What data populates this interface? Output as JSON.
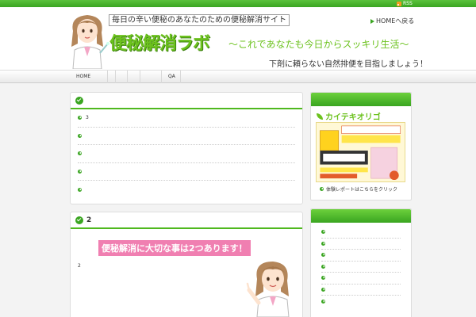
{
  "topbar": {
    "rss_label": "RSS"
  },
  "header": {
    "tagline": "毎日の辛い便秘のあなたのための便秘解消サイト",
    "home_back": "HOMEへ戻る",
    "site_title": "便秘解消ラボ",
    "site_subtitle": "〜これであなたも今日からスッキリ生活〜",
    "site_description": "下剤に頼らない自然排便を目指しましょう！"
  },
  "nav": {
    "items": [
      "HOME",
      "",
      "",
      "",
      "",
      "QA"
    ]
  },
  "main": {
    "card1": {
      "title": "",
      "items": [
        "3",
        "",
        "",
        "",
        ""
      ]
    },
    "card2": {
      "title": "2",
      "banner": "便秘解消に大切な事は2つあります！",
      "body": "2"
    }
  },
  "sidebar": {
    "banner": {
      "title": "カイテキオリゴ",
      "link_text": "体験レポートはこちらをクリック"
    },
    "list": {
      "items": [
        "",
        "",
        "",
        "",
        "",
        "",
        ""
      ]
    }
  },
  "colors": {
    "accent": "#3aa521",
    "title_green": "#6cc21e",
    "banner_pink": "#f07fb1"
  }
}
